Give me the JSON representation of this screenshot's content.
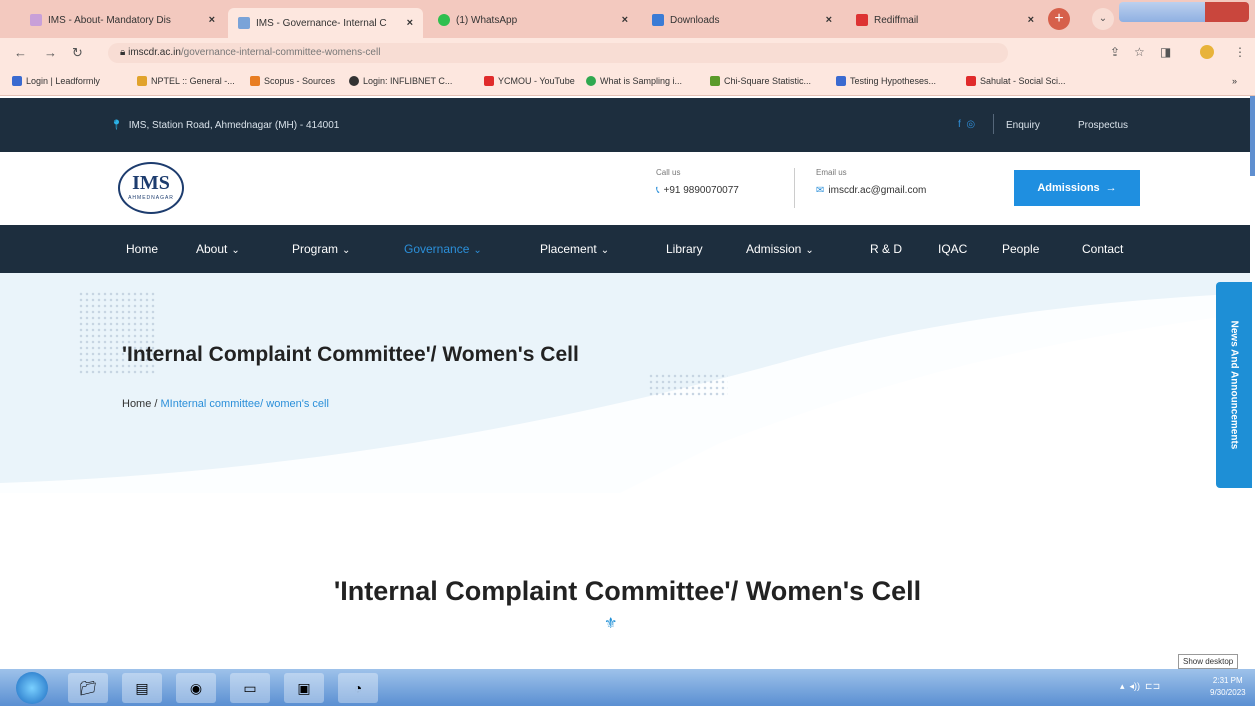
{
  "browser": {
    "tabs": [
      {
        "title": "IMS - About- Mandatory Dis",
        "fav_color": "#c8a0d8"
      },
      {
        "title": "IMS - Governance- Internal C",
        "fav_color": "#7aa3d8"
      },
      {
        "title": "(1) WhatsApp",
        "fav_color": "#2fbf4f"
      },
      {
        "title": "Downloads",
        "fav_color": "#3a7bd5"
      },
      {
        "title": "Rediffmail",
        "fav_color": "#d33"
      }
    ],
    "close_glyph": "×",
    "url_host": "imscdr.ac.in",
    "url_path": "/governance-internal-committee-womens-cell",
    "bookmarks": [
      {
        "label": "Login | Leadformly",
        "color": "#3a6ad0"
      },
      {
        "label": "NPTEL :: General -...",
        "color": "#e1a32c"
      },
      {
        "label": "Scopus - Sources",
        "color": "#e87d22"
      },
      {
        "label": "Login: INFLIBNET C...",
        "color": "#333333"
      },
      {
        "label": "YCMOU - YouTube",
        "color": "#e02b2b"
      },
      {
        "label": "What is Sampling i...",
        "color": "#2fa84f"
      },
      {
        "label": "Chi-Square Statistic...",
        "color": "#5a9a2a"
      },
      {
        "label": "Testing Hypotheses...",
        "color": "#3a6ad0"
      },
      {
        "label": "Sahulat - Social Sci...",
        "color": "#e02b2b"
      }
    ]
  },
  "topbar": {
    "address": "IMS, Station Road, Ahmednagar (MH) - 414001",
    "enquiry": "Enquiry",
    "prospectus": "Prospectus"
  },
  "header": {
    "logo_text": "IMS",
    "logo_sub": "AHMEDNAGAR",
    "call_label": "Call us",
    "phone": "+91 9890070077",
    "email_label": "Email us",
    "email": "imscdr.ac@gmail.com",
    "admissions_label": "Admissions"
  },
  "nav": {
    "items": [
      {
        "label": "Home",
        "dropdown": false
      },
      {
        "label": "About",
        "dropdown": true
      },
      {
        "label": "Program",
        "dropdown": true
      },
      {
        "label": "Governance",
        "dropdown": true,
        "active": true
      },
      {
        "label": "Placement",
        "dropdown": true
      },
      {
        "label": "Library",
        "dropdown": false
      },
      {
        "label": "Admission",
        "dropdown": true
      },
      {
        "label": "R & D",
        "dropdown": false
      },
      {
        "label": "IQAC",
        "dropdown": false
      },
      {
        "label": "People",
        "dropdown": false
      },
      {
        "label": "Contact",
        "dropdown": false
      }
    ]
  },
  "hero": {
    "title": "'Internal Complaint Committee'/ Women's Cell",
    "breadcrumb_home": "Home",
    "breadcrumb_sep": " / ",
    "breadcrumb_current": "MInternal committee/ women's cell"
  },
  "side_tab": "News And Announcements",
  "content": {
    "title": "'Internal Complaint Committee'/ Women's Cell"
  },
  "taskbar": {
    "show_desktop": "Show desktop",
    "time": "2:31 PM",
    "date": "9/30/2023"
  },
  "colors": {
    "dark_navy": "#1d2e3e",
    "accent_blue": "#1f8fe0"
  }
}
